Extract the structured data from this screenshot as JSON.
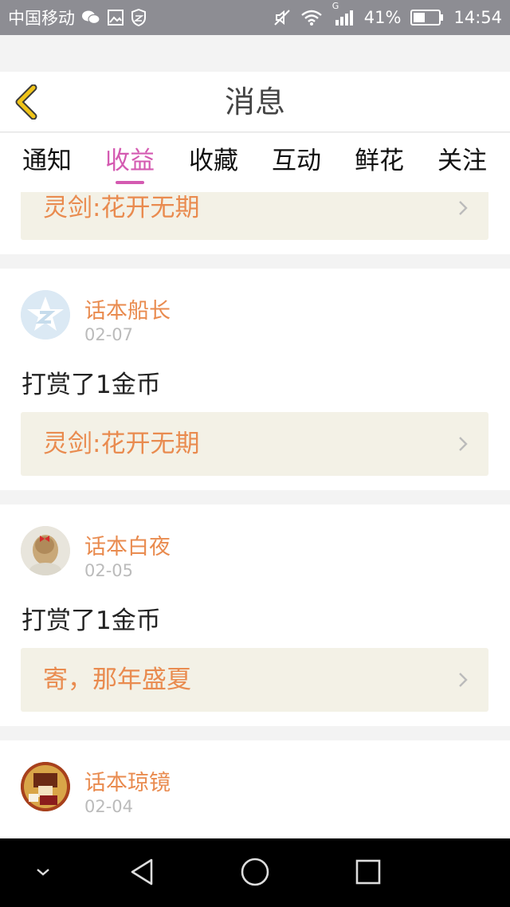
{
  "status_bar": {
    "carrier": "中国移动",
    "battery": "41%",
    "time": "14:54",
    "network": "G",
    "icons": [
      "wechat-icon",
      "gallery-icon",
      "shield-icon",
      "mute-icon",
      "wifi-icon",
      "signal-icon",
      "battery-icon"
    ]
  },
  "header": {
    "title": "消息",
    "back_icon": "chevron-left-icon"
  },
  "tabs": [
    {
      "label": "通知",
      "active": false
    },
    {
      "label": "收益",
      "active": true
    },
    {
      "label": "收藏",
      "active": false
    },
    {
      "label": "互动",
      "active": false
    },
    {
      "label": "鲜花",
      "active": false
    },
    {
      "label": "关注",
      "active": false
    }
  ],
  "feed": {
    "partial_top_book": "灵剑:花开无期",
    "items": [
      {
        "user": "话本船长",
        "date": "02-07",
        "message": "打赏了1金币",
        "book": "灵剑:花开无期"
      },
      {
        "user": "话本白夜",
        "date": "02-05",
        "message": "打赏了1金币",
        "book": "寄，那年盛夏"
      },
      {
        "user": "话本琼镜",
        "date": "02-04"
      }
    ]
  },
  "colors": {
    "accent_tab": "#d45ab1",
    "name_orange": "#e98b4f",
    "book_bg": "#f3f1e6",
    "back_icon": "#f0c419"
  },
  "nav_bar": {
    "icons": [
      "collapse-icon",
      "back-triangle-icon",
      "home-circle-icon",
      "recent-square-icon"
    ]
  }
}
